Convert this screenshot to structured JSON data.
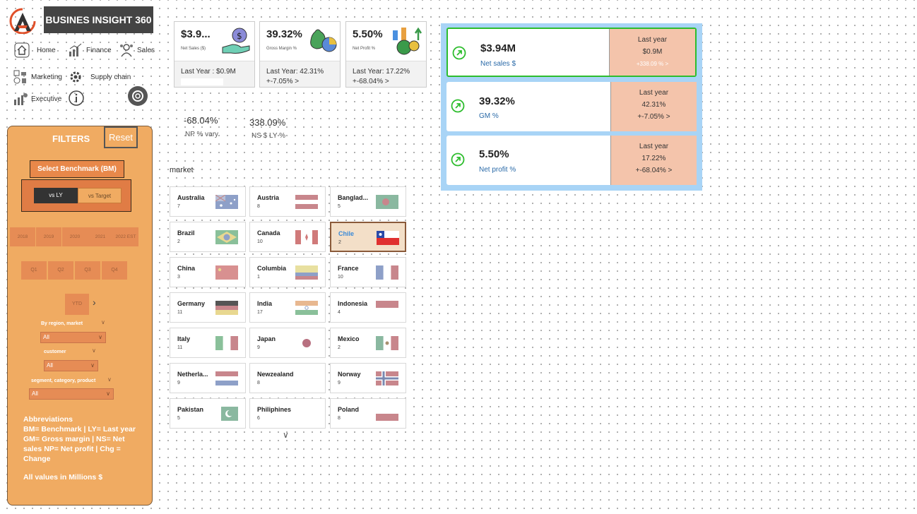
{
  "brand": {
    "title": "BUSINES INSIGHT 360"
  },
  "nav": [
    {
      "label": "Home",
      "icon": "home-icon"
    },
    {
      "label": "Finance",
      "icon": "finance-chart-icon"
    },
    {
      "label": "Sales",
      "icon": "sales-icon"
    },
    {
      "label": "Marketing",
      "icon": "marketing-icon"
    },
    {
      "label": "Supply chain",
      "icon": "supply-chain-icon"
    },
    {
      "label": "Executive",
      "icon": "executive-icon"
    }
  ],
  "filters": {
    "title": "FILTERS",
    "reset": "Reset",
    "benchmark_label": "Select Benchmark (BM)",
    "toggle": [
      "vs LY",
      "vs Target"
    ],
    "years": [
      "2018",
      "2019",
      "2020",
      "2021",
      "2022 EST"
    ],
    "quarters": [
      "Q1",
      "Q2",
      "Q3",
      "Q4"
    ],
    "ytd": "YTD",
    "slicers": [
      {
        "label": "By region, market",
        "value": "All"
      },
      {
        "label": "customer",
        "value": "All"
      },
      {
        "label": "segment, category, product",
        "value": "All"
      }
    ],
    "abbreviations_title": "Abbreviations",
    "abbreviations": "BM= Benchmark | LY= Last year GM= Gross margin | NS= Net sales NP= Net profit | Chg = Change",
    "units_note": "All values in Millions $"
  },
  "kpis": [
    {
      "value": "$3.9...",
      "label": "Net Sales ($)",
      "ly": "Last Year : $0.9M",
      "chg": ""
    },
    {
      "value": "39.32%",
      "label": "Gross Margin %",
      "ly": "Last Year: 42.31%",
      "chg": "+-7.05% >"
    },
    {
      "value": "5.50%",
      "label": "Net Profit %",
      "ly": "Last Year: 17.22%",
      "chg": "+-68.04% >"
    }
  ],
  "variance": [
    {
      "value": "-68.04%",
      "label": "NP % vary"
    },
    {
      "value": "338.09%",
      "label": "NS $ LY %"
    }
  ],
  "market": {
    "label": "market",
    "tiles": [
      {
        "name": "Australia",
        "count": "7",
        "flag": "australia"
      },
      {
        "name": "Austria",
        "count": "8",
        "flag": "austria"
      },
      {
        "name": "Banglad...",
        "count": "5",
        "flag": "bangladesh"
      },
      {
        "name": "Brazil",
        "count": "2",
        "flag": "brazil"
      },
      {
        "name": "Canada",
        "count": "10",
        "flag": "canada"
      },
      {
        "name": "Chile",
        "count": "2",
        "flag": "chile",
        "selected": true
      },
      {
        "name": "China",
        "count": "3",
        "flag": "china"
      },
      {
        "name": "Columbia",
        "count": "1",
        "flag": "colombia"
      },
      {
        "name": "France",
        "count": "10",
        "flag": "france"
      },
      {
        "name": "Germany",
        "count": "11",
        "flag": "germany"
      },
      {
        "name": "India",
        "count": "17",
        "flag": "india"
      },
      {
        "name": "Indonesia",
        "count": "4",
        "flag": "indonesia"
      },
      {
        "name": "Italy",
        "count": "11",
        "flag": "italy"
      },
      {
        "name": "Japan",
        "count": "9",
        "flag": "japan"
      },
      {
        "name": "Mexico",
        "count": "2",
        "flag": "mexico"
      },
      {
        "name": "Netherla...",
        "count": "9",
        "flag": "netherlands"
      },
      {
        "name": "Newzealand",
        "count": "8",
        "flag": "none"
      },
      {
        "name": "Norway",
        "count": "9",
        "flag": "norway"
      },
      {
        "name": "Pakistan",
        "count": "5",
        "flag": "pakistan"
      },
      {
        "name": "Philiphines",
        "count": "6",
        "flag": "none"
      },
      {
        "name": "Poland",
        "count": "8",
        "flag": "poland"
      }
    ]
  },
  "summary": [
    {
      "value": "$3.94M",
      "label": "Net sales $",
      "ly_title": "Last year",
      "ly_value": "$0.9M",
      "chg": "+338.09 % >"
    },
    {
      "value": "39.32%",
      "label": "GM %",
      "ly_title": "Last year",
      "ly_value": "42.31%",
      "chg": "+-7.05% >"
    },
    {
      "value": "5.50%",
      "label": "Net profit %",
      "ly_title": "Last year",
      "ly_value": "17.22%",
      "chg": "+-68.04% >"
    }
  ],
  "colors": {
    "filter_panel": "#f0ab62",
    "summary_panel": "#a8d4f6",
    "positive": "#2dbd2d",
    "ly_box": "#f4c4ab"
  }
}
